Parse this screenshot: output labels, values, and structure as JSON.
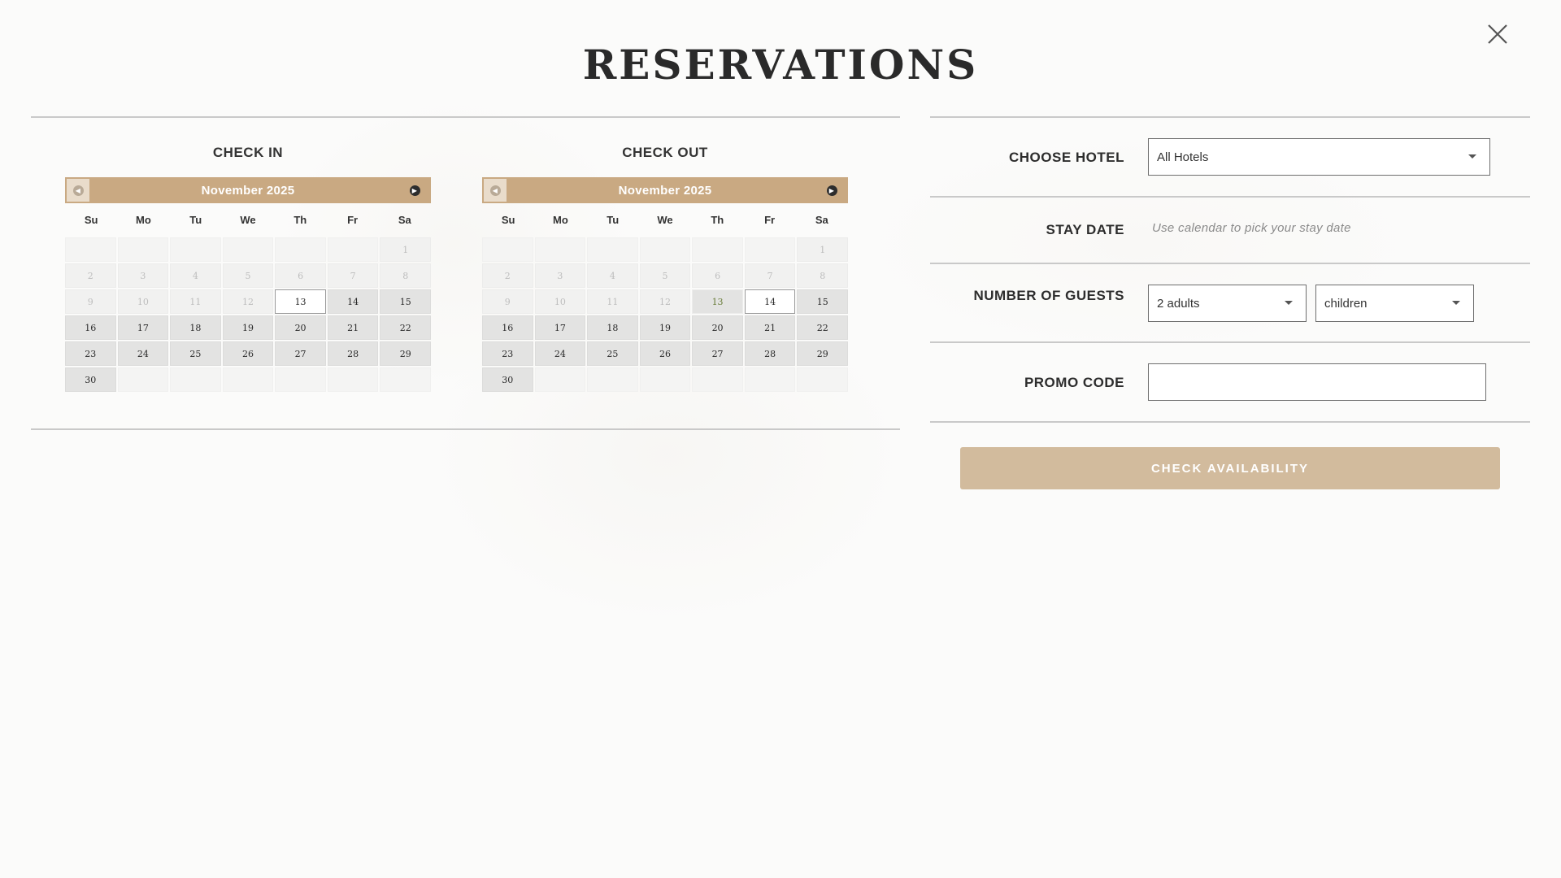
{
  "modal": {
    "title": "RESERVATIONS",
    "close_icon": "close-icon"
  },
  "checkin": {
    "heading": "CHECK IN",
    "month_label": "November 2025",
    "weekdays": [
      "Su",
      "Mo",
      "Tu",
      "We",
      "Th",
      "Fr",
      "Sa"
    ],
    "days": [
      {
        "d": "",
        "s": "empty"
      },
      {
        "d": "",
        "s": "empty"
      },
      {
        "d": "",
        "s": "empty"
      },
      {
        "d": "",
        "s": "empty"
      },
      {
        "d": "",
        "s": "empty"
      },
      {
        "d": "",
        "s": "empty"
      },
      {
        "d": "1",
        "s": "disabled"
      },
      {
        "d": "2",
        "s": "disabled"
      },
      {
        "d": "3",
        "s": "disabled"
      },
      {
        "d": "4",
        "s": "disabled"
      },
      {
        "d": "5",
        "s": "disabled"
      },
      {
        "d": "6",
        "s": "disabled"
      },
      {
        "d": "7",
        "s": "disabled"
      },
      {
        "d": "8",
        "s": "disabled"
      },
      {
        "d": "9",
        "s": "disabled"
      },
      {
        "d": "10",
        "s": "disabled"
      },
      {
        "d": "11",
        "s": "disabled"
      },
      {
        "d": "12",
        "s": "disabled"
      },
      {
        "d": "13",
        "s": "selected"
      },
      {
        "d": "14",
        "s": "active"
      },
      {
        "d": "15",
        "s": "active"
      },
      {
        "d": "16",
        "s": "active"
      },
      {
        "d": "17",
        "s": "active"
      },
      {
        "d": "18",
        "s": "active"
      },
      {
        "d": "19",
        "s": "active"
      },
      {
        "d": "20",
        "s": "active"
      },
      {
        "d": "21",
        "s": "active"
      },
      {
        "d": "22",
        "s": "active"
      },
      {
        "d": "23",
        "s": "active"
      },
      {
        "d": "24",
        "s": "active"
      },
      {
        "d": "25",
        "s": "active"
      },
      {
        "d": "26",
        "s": "active"
      },
      {
        "d": "27",
        "s": "active"
      },
      {
        "d": "28",
        "s": "active"
      },
      {
        "d": "29",
        "s": "active"
      },
      {
        "d": "30",
        "s": "active"
      },
      {
        "d": "",
        "s": "empty"
      },
      {
        "d": "",
        "s": "empty"
      },
      {
        "d": "",
        "s": "empty"
      },
      {
        "d": "",
        "s": "empty"
      },
      {
        "d": "",
        "s": "empty"
      },
      {
        "d": "",
        "s": "empty"
      }
    ]
  },
  "checkout": {
    "heading": "CHECK OUT",
    "month_label": "November 2025",
    "weekdays": [
      "Su",
      "Mo",
      "Tu",
      "We",
      "Th",
      "Fr",
      "Sa"
    ],
    "days": [
      {
        "d": "",
        "s": "empty"
      },
      {
        "d": "",
        "s": "empty"
      },
      {
        "d": "",
        "s": "empty"
      },
      {
        "d": "",
        "s": "empty"
      },
      {
        "d": "",
        "s": "empty"
      },
      {
        "d": "",
        "s": "empty"
      },
      {
        "d": "1",
        "s": "disabled"
      },
      {
        "d": "2",
        "s": "disabled"
      },
      {
        "d": "3",
        "s": "disabled"
      },
      {
        "d": "4",
        "s": "disabled"
      },
      {
        "d": "5",
        "s": "disabled"
      },
      {
        "d": "6",
        "s": "disabled"
      },
      {
        "d": "7",
        "s": "disabled"
      },
      {
        "d": "8",
        "s": "disabled"
      },
      {
        "d": "9",
        "s": "disabled"
      },
      {
        "d": "10",
        "s": "disabled"
      },
      {
        "d": "11",
        "s": "disabled"
      },
      {
        "d": "12",
        "s": "disabled"
      },
      {
        "d": "13",
        "s": "range"
      },
      {
        "d": "14",
        "s": "selected"
      },
      {
        "d": "15",
        "s": "active"
      },
      {
        "d": "16",
        "s": "active"
      },
      {
        "d": "17",
        "s": "active"
      },
      {
        "d": "18",
        "s": "active"
      },
      {
        "d": "19",
        "s": "active"
      },
      {
        "d": "20",
        "s": "active"
      },
      {
        "d": "21",
        "s": "active"
      },
      {
        "d": "22",
        "s": "active"
      },
      {
        "d": "23",
        "s": "active"
      },
      {
        "d": "24",
        "s": "active"
      },
      {
        "d": "25",
        "s": "active"
      },
      {
        "d": "26",
        "s": "active"
      },
      {
        "d": "27",
        "s": "active"
      },
      {
        "d": "28",
        "s": "active"
      },
      {
        "d": "29",
        "s": "active"
      },
      {
        "d": "30",
        "s": "active"
      },
      {
        "d": "",
        "s": "empty"
      },
      {
        "d": "",
        "s": "empty"
      },
      {
        "d": "",
        "s": "empty"
      },
      {
        "d": "",
        "s": "empty"
      },
      {
        "d": "",
        "s": "empty"
      },
      {
        "d": "",
        "s": "empty"
      }
    ]
  },
  "form": {
    "choose_hotel_label": "CHOOSE HOTEL",
    "hotel_value": "All Hotels",
    "stay_date_label": "STAY DATE",
    "stay_date_hint": "Use calendar to pick your stay date",
    "guests_label": "NUMBER OF GUESTS",
    "adults_value": "2 adults",
    "children_value": "children",
    "promo_label": "PROMO CODE",
    "promo_value": "",
    "submit_label": "CHECK AVAILABILITY"
  },
  "colors": {
    "accent": "#c9a982",
    "button": "#d2bb9d",
    "range_day_text": "#6a7d3a"
  }
}
